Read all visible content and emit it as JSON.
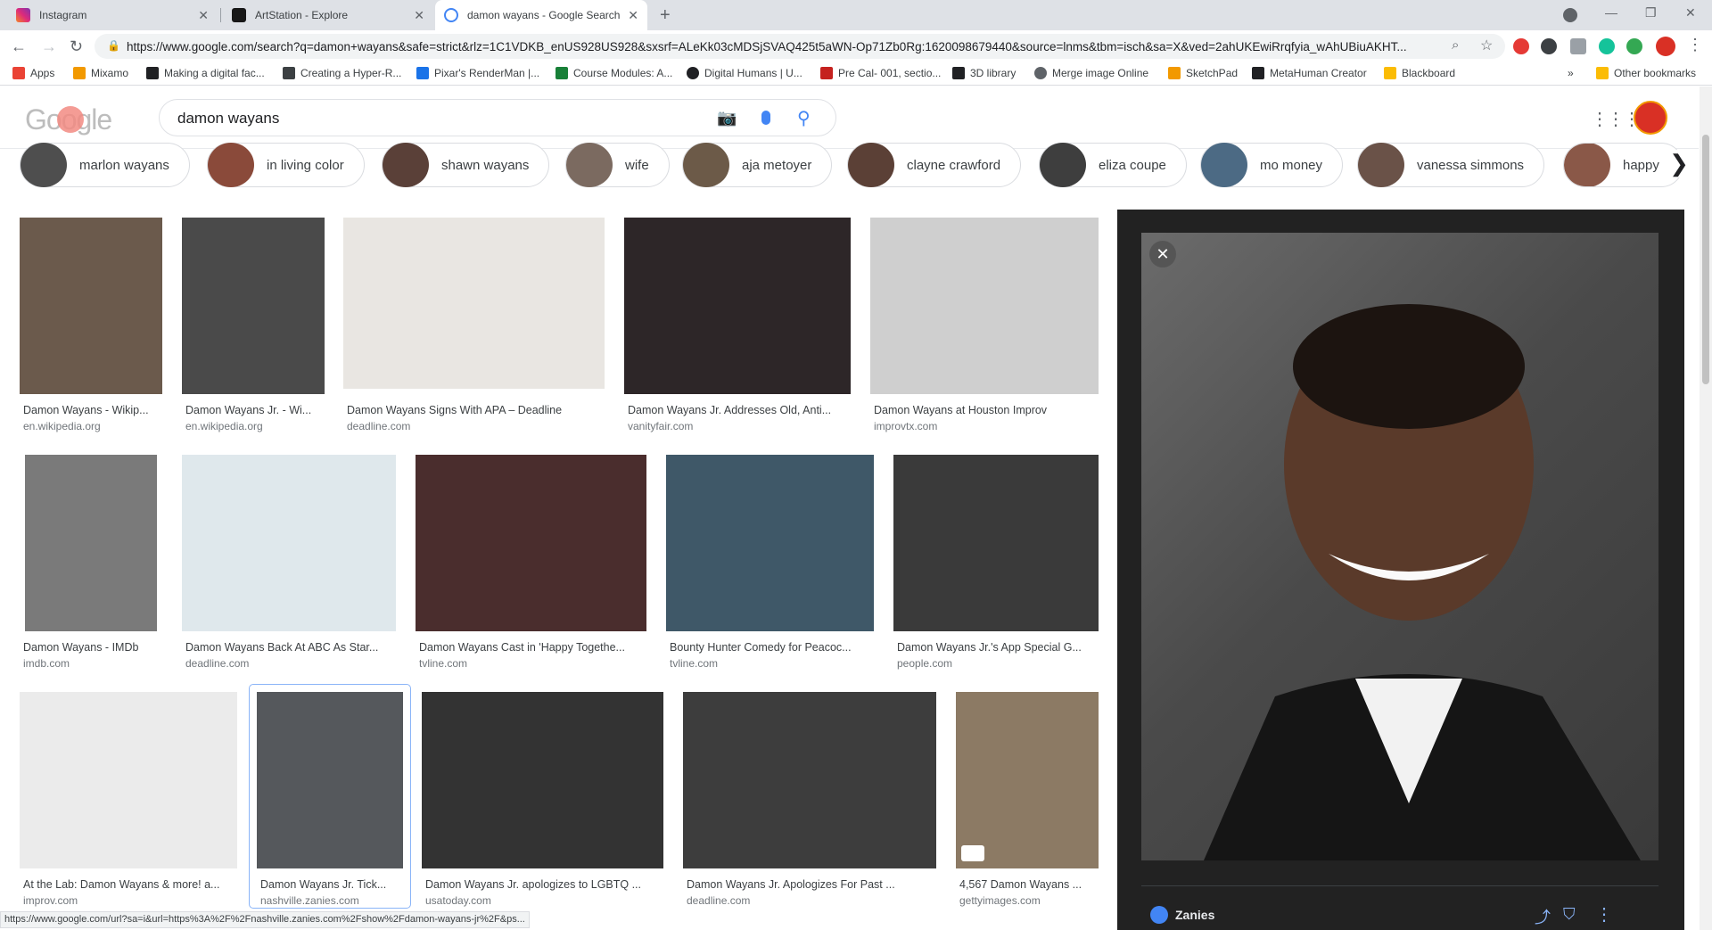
{
  "tabs": [
    {
      "title": "Instagram",
      "color": "#e1306c"
    },
    {
      "title": "ArtStation - Explore",
      "color": "#13aff0"
    },
    {
      "title": "damon wayans - Google Search",
      "color": "#4285f4"
    }
  ],
  "address": {
    "url": "https://www.google.com/search?q=damon+wayans&safe=strict&rlz=1C1VDKB_enUS928US928&sxsrf=ALeKk03cMDSjSVAQ425t5aWN-Op71Zb0Rg:1620098679440&source=lnms&tbm=isch&sa=X&ved=2ahUKEwiRrqfyia_wAhUBiuAKHT..."
  },
  "bookmarks": [
    {
      "label": "Apps",
      "icon": "apps-grid-icon",
      "color": "#ea4335"
    },
    {
      "label": "Mixamo",
      "icon": "mixamo-icon",
      "color": "#f29900"
    },
    {
      "label": "Making a digital fac...",
      "icon": "bookmark-icon",
      "color": "#202124"
    },
    {
      "label": "Creating a Hyper-R...",
      "icon": "bookmark-icon",
      "color": "#3c4043"
    },
    {
      "label": "Pixar's RenderMan |...",
      "icon": "renderman-icon",
      "color": "#1a73e8"
    },
    {
      "label": "Course Modules: A...",
      "icon": "ed-icon",
      "color": "#188038"
    },
    {
      "label": "Digital Humans | U...",
      "icon": "unreal-icon",
      "color": "#202124"
    },
    {
      "label": "Pre Cal- 001, sectio...",
      "icon": "pearson-icon",
      "color": "#c5221f"
    },
    {
      "label": "3D library",
      "icon": "3d-library-icon",
      "color": "#202124"
    },
    {
      "label": "Merge image Online",
      "icon": "globe-icon",
      "color": "#5f6368"
    },
    {
      "label": "SketchPad",
      "icon": "sketchpad-icon",
      "color": "#f29900"
    },
    {
      "label": "MetaHuman Creator",
      "icon": "metahuman-icon",
      "color": "#202124"
    },
    {
      "label": "Blackboard",
      "icon": "folder-icon",
      "color": "#fbbc04"
    }
  ],
  "bookmarks_more": "»",
  "other_bookmarks": "Other bookmarks",
  "search": {
    "query": "damon wayans"
  },
  "logo": "Google",
  "chips": [
    "marlon wayans",
    "in living color",
    "shawn wayans",
    "wife",
    "aja metoyer",
    "clayne crawford",
    "eliza coupe",
    "mo money",
    "vanessa simmons",
    "happy"
  ],
  "results": [
    {
      "title": "Damon Wayans - Wikip...",
      "source": "en.wikipedia.org",
      "color": "#6b5a4c"
    },
    {
      "title": "Damon Wayans Jr. - Wi...",
      "source": "en.wikipedia.org",
      "color": "#4a4a4a"
    },
    {
      "title": "Damon Wayans Signs With APA – Deadline",
      "source": "deadline.com",
      "color": "#e9e6e2"
    },
    {
      "title": "Damon Wayans Jr. Addresses Old, Anti...",
      "source": "vanityfair.com",
      "color": "#2d2628"
    },
    {
      "title": "Damon Wayans at Houston Improv",
      "source": "improvtx.com",
      "color": "#cfcfcf"
    },
    {
      "title": "Damon Wayans - IMDb",
      "source": "imdb.com",
      "color": "#7a7a7a"
    },
    {
      "title": "Damon Wayans Back At ABC As Star...",
      "source": "deadline.com",
      "color": "#dfe8ec"
    },
    {
      "title": "Damon Wayans Cast in 'Happy Togethe...",
      "source": "tvline.com",
      "color": "#4a2d2d"
    },
    {
      "title": "Bounty Hunter Comedy for Peacoc...",
      "source": "tvline.com",
      "color": "#3f5868"
    },
    {
      "title": "Damon Wayans Jr.'s App Special G...",
      "source": "people.com",
      "color": "#3a3a3a"
    },
    {
      "title": "At the Lab: Damon Wayans & more! a...",
      "source": "improv.com",
      "color": "#ebebeb"
    },
    {
      "title": "Damon Wayans Jr. Tick...",
      "source": "nashville.zanies.com",
      "color": "#55585c"
    },
    {
      "title": "Damon Wayans Jr. apologizes to LGBTQ ...",
      "source": "usatoday.com",
      "color": "#333333"
    },
    {
      "title": "Damon Wayans Jr. Apologizes For Past ...",
      "source": "deadline.com",
      "color": "#3d3d3d"
    },
    {
      "title": "4,567 Damon Wayans ...",
      "source": "gettyimages.com",
      "color": "#8c7a64"
    }
  ],
  "preview": {
    "source_name": "Zanies"
  },
  "status_url": "https://www.google.com/url?sa=i&url=https%3A%2F%2Fnashville.zanies.com%2Fshow%2Fdamon-wayans-jr%2F&ps...",
  "accent": "#1a73e8"
}
